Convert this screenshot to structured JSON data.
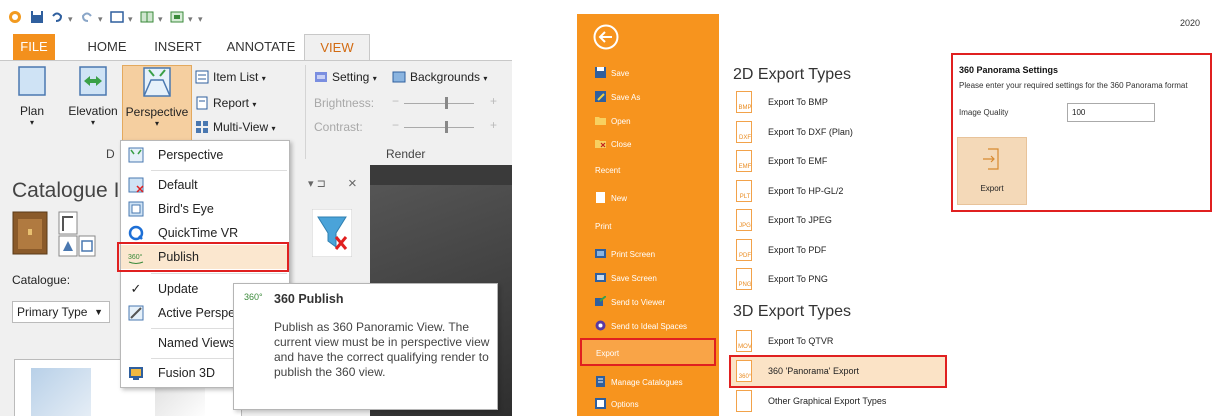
{
  "left_app": {
    "ribbon_tabs": [
      "FILE",
      "HOME",
      "INSERT",
      "ANNOTATE",
      "VIEW"
    ],
    "buttons": {
      "plan": "Plan",
      "elevation": "Elevation",
      "perspective": "Perspective"
    },
    "small_buttons": {
      "item_list": "Item List",
      "report": "Report",
      "multi_view": "Multi-View",
      "setting": "Setting",
      "backgrounds": "Backgrounds"
    },
    "slider_labels": {
      "brightness": "Brightness:",
      "contrast": "Contrast:"
    },
    "group_labels": {
      "render": "Render",
      "cut_letter": "D"
    },
    "catalogue_panel": {
      "title": "Catalogue I",
      "catalogue_label": "Catalogue:",
      "primary_type": "Primary Type",
      "pin": "− q",
      "close": "×"
    },
    "menu": {
      "items": [
        "Perspective",
        "Default",
        "Bird's Eye",
        "QuickTime VR",
        "Publish",
        "Update",
        "Active Perspe",
        "Named Views",
        "Fusion 3D"
      ],
      "update_check": "✓"
    },
    "tooltip": {
      "title": "360 Publish",
      "icon_text": "360°",
      "body": "Publish as 360 Panoramic View. The current view must be in perspective view and have the correct qualifying render to publish the 360 view."
    }
  },
  "right_app": {
    "year": "2020",
    "sidebar": {
      "items": [
        "Save",
        "Save As",
        "Open",
        "Close"
      ],
      "headers": {
        "recent": "Recent",
        "print": "Print"
      },
      "new": "New",
      "print_items": [
        "Print Screen",
        "Save Screen",
        "Send to Viewer",
        "Send to Ideal Spaces"
      ],
      "export": "Export",
      "bottom_items": [
        "Manage Catalogues",
        "Options"
      ]
    },
    "export_2d": {
      "title": "2D Export Types",
      "items": [
        {
          "icon": "BMP",
          "label": "Export To BMP"
        },
        {
          "icon": "DXF",
          "label": "Export To DXF (Plan)"
        },
        {
          "icon": "EMF",
          "label": "Export To EMF"
        },
        {
          "icon": "PLT",
          "label": "Export To HP-GL/2"
        },
        {
          "icon": "JPG",
          "label": "Export To JPEG"
        },
        {
          "icon": "PDF",
          "label": "Export To PDF"
        },
        {
          "icon": "PNG",
          "label": "Export To PNG"
        }
      ]
    },
    "export_3d": {
      "title": "3D Export Types",
      "items": [
        {
          "icon": "MOV",
          "label": "Export To QTVR"
        },
        {
          "icon": "360°",
          "label": "360 'Panorama' Export"
        },
        {
          "icon": "",
          "label": "Other Graphical Export Types"
        }
      ]
    },
    "panorama_settings": {
      "title": "360 Panorama Settings",
      "subtitle": "Please enter your required settings for the 360 Panorama format",
      "quality_label": "Image Quality",
      "quality_value": "100",
      "export_button": "Export"
    }
  },
  "colors": {
    "accent_orange": "#f7941e",
    "highlight_red": "#e02020",
    "hover_bg": "#fbe7cf"
  }
}
